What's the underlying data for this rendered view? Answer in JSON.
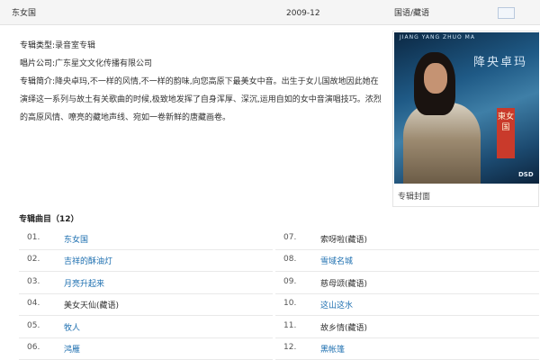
{
  "album_row": {
    "name": "东女国",
    "date": "2009-12",
    "language": "国语/藏语",
    "icon": "image-icon"
  },
  "info": {
    "type_label": "专辑类型:",
    "type_value": "录音室专辑",
    "label_label": "唱片公司:",
    "label_value": "广东星文文化传播有限公司",
    "desc_label": "专辑简介:",
    "description": "降央卓玛,不一样的风情,不一样的韵味,向您高原下最美女中音。出生于女儿国故地因此她在演绎这一系列与故土有关歌曲的时候,极致地发挥了自身浑厚、深沉,运用自如的女中音演唱技巧。浓烈的高原风情、嘹亮的藏地声线、宛如一卷新鲜的唐藏画卷。"
  },
  "cover": {
    "caption": "专辑封面",
    "top_text": "JIANG YANG ZHUO MA",
    "art_title": "降央卓玛",
    "badge": "東女国",
    "format": "DSD"
  },
  "tracks_heading": "专辑曲目（12）",
  "tracks_left": [
    {
      "no": "01.",
      "title": "东女国",
      "link": true
    },
    {
      "no": "02.",
      "title": "吉祥的酥油灯",
      "link": true
    },
    {
      "no": "03.",
      "title": "月亮升起来",
      "link": true
    },
    {
      "no": "04.",
      "title": "美女天仙(藏语)",
      "link": false
    },
    {
      "no": "05.",
      "title": "牧人",
      "link": true
    },
    {
      "no": "06.",
      "title": "鸿雁",
      "link": true
    }
  ],
  "tracks_right": [
    {
      "no": "07.",
      "title": "索呀啦(藏语)",
      "link": false
    },
    {
      "no": "08.",
      "title": "雪域名城",
      "link": true
    },
    {
      "no": "09.",
      "title": "慈母颂(藏语)",
      "link": false
    },
    {
      "no": "10.",
      "title": "这山这水",
      "link": true
    },
    {
      "no": "11.",
      "title": "故乡情(藏语)",
      "link": false
    },
    {
      "no": "12.",
      "title": "黑帐篷",
      "link": true
    }
  ]
}
